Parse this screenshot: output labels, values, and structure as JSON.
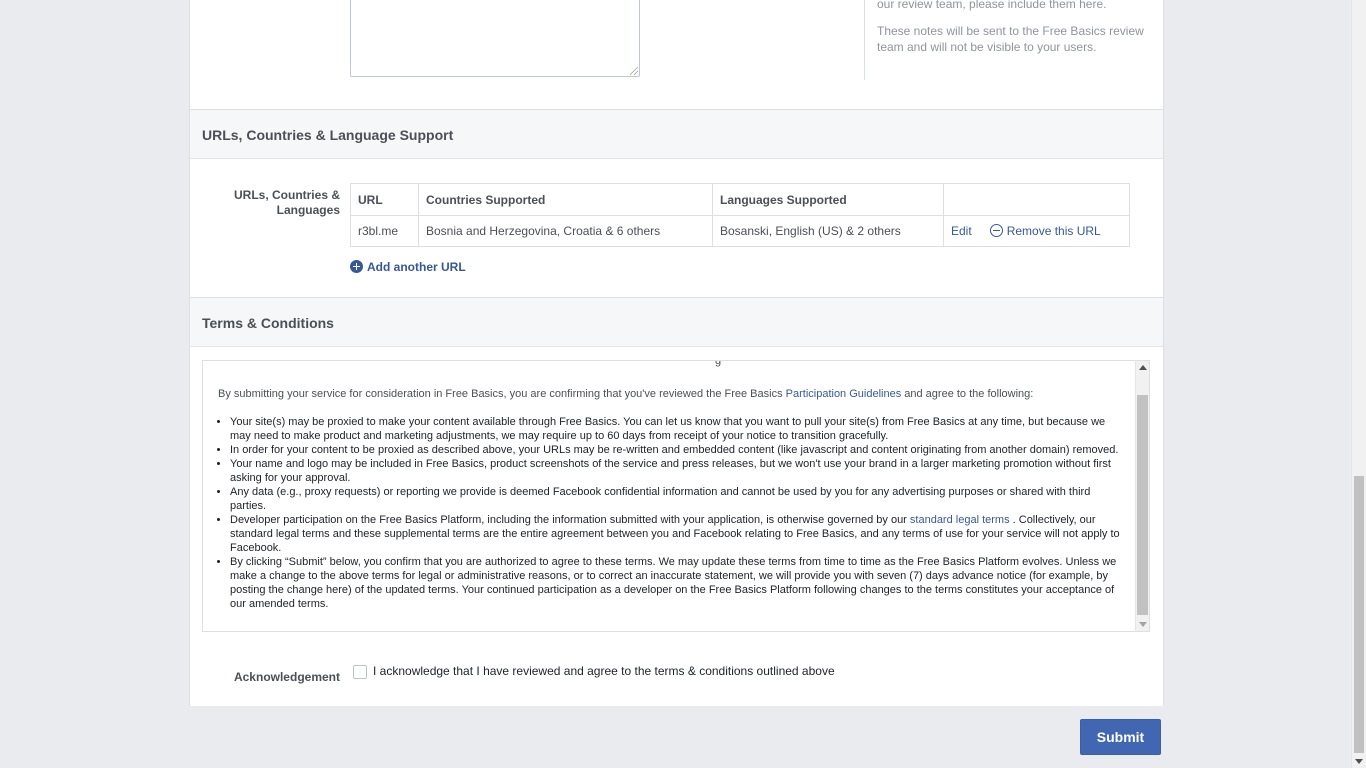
{
  "notes": {
    "label_fragment": "g",
    "help_line_1": "our review team, please include them here.",
    "help_line_2": "These notes will be sent to the Free Basics review team and will not be visible to your users."
  },
  "urls_section": {
    "title": "URLs, Countries & Language Support",
    "row_label": "URLs, Countries & Languages",
    "table": {
      "headers": [
        "URL",
        "Countries Supported",
        "Languages Supported",
        ""
      ],
      "rows": [
        {
          "url": "r3bl.me",
          "countries": "Bosnia and Herzegovina, Croatia & 6 others",
          "languages": "Bosanski, English (US) & 2 others",
          "edit_label": "Edit",
          "remove_label": "Remove this URL"
        }
      ]
    },
    "add_label": "Add another URL"
  },
  "terms_section": {
    "title": "Terms & Conditions",
    "intro_before": "By submitting your service for consideration in Free Basics, you are confirming that you've reviewed the Free Basics ",
    "intro_link": "Participation Guidelines",
    "intro_after": " and agree to the following:",
    "items": [
      "Your site(s) may be proxied to make your content available through Free Basics. You can let us know that you want to pull your site(s) from Free Basics at any time, but because we may need to make product and marketing adjustments, we may require up to 60 days from receipt of your notice to transition gracefully.",
      "In order for your content to be proxied as described above, your URLs may be re-written and embedded content (like javascript and content originating from another domain) removed.",
      "Your name and logo may be included in Free Basics, product screenshots of the service and press releases, but we won't use your brand in a larger marketing promotion without first asking for your approval.",
      "Any data (e.g., proxy requests) or reporting we provide is deemed Facebook confidential information and cannot be used by you for any advertising purposes or shared with third parties."
    ],
    "item5_before": "Developer participation on the Free Basics Platform, including the information submitted with your application, is otherwise governed by our ",
    "item5_link": "standard legal terms",
    "item5_after": " . Collectively, our standard legal terms and these supplemental terms are the entire agreement between you and Facebook relating to Free Basics, and any terms of use for your service will not apply to Facebook.",
    "item6": "By clicking “Submit” below, you confirm that you are authorized to agree to these terms. We may update these terms from time to time as the Free Basics Platform evolves. Unless we make a change to the above terms for legal or administrative reasons, or to correct an inaccurate statement, we will provide you with seven (7) days advance notice (for example, by posting the change here) of the updated terms. Your continued participation as a developer on the Free Basics Platform following changes to the terms constitutes your acceptance of our amended terms.",
    "cut_glyph": "g"
  },
  "acknowledgement": {
    "label": "Acknowledgement",
    "checkbox_text": "I acknowledge that I have reviewed and agree to the terms & conditions outlined above",
    "checked": false
  },
  "submit_label": "Submit"
}
